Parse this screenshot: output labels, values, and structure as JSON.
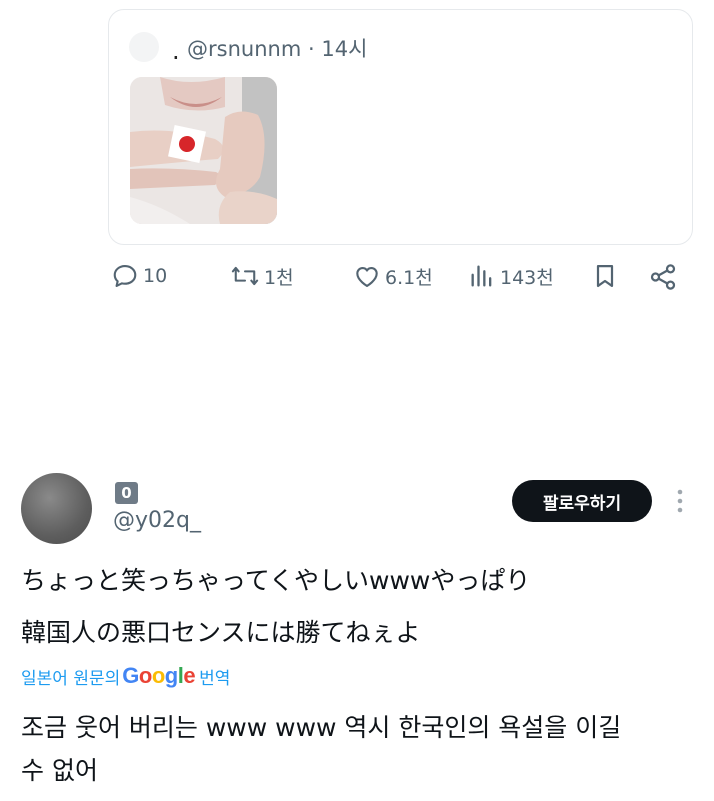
{
  "quoted_post": {
    "handle": "@rsnunnm",
    "time": "14시",
    "separator": "·"
  },
  "actions": {
    "replies": "10",
    "reposts": "1천",
    "likes": "6.1천",
    "views": "143천"
  },
  "author": {
    "display_name": "0",
    "handle": "@y02q_"
  },
  "follow_label": "팔로우하기",
  "post": {
    "lines": [
      "ちょっと笑っちゃってくやしいwwwやっぱり",
      "韓国人の悪口センスには勝てねぇよ"
    ]
  },
  "translate": {
    "prefix": "일본어 원문의",
    "suffix": "번역",
    "google": [
      "G",
      "o",
      "o",
      "g",
      "l",
      "e"
    ]
  },
  "translation": {
    "lines": [
      "조금 웃어 버리는 www www 역시 한국인의 욕설을 이길",
      "수 없어"
    ]
  },
  "colors": {
    "accent": "#1d9bf0",
    "text_primary": "#0f1419",
    "text_secondary": "#536471",
    "follow_button_bg": "#0f1419"
  },
  "icons": [
    "reply-icon",
    "repost-icon",
    "like-icon",
    "views-icon",
    "bookmark-icon",
    "share-icon",
    "more-icon"
  ]
}
